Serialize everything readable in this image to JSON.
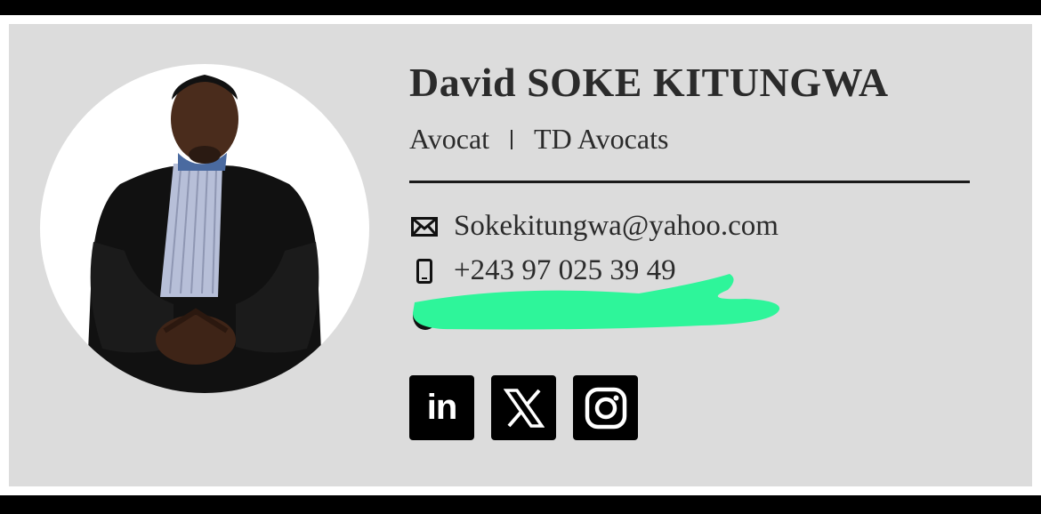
{
  "profile": {
    "name": "David SOKE KITUNGWA",
    "title": "Avocat",
    "company": "TD Avocats"
  },
  "contact": {
    "email": "Sokekitungwa@yahoo.com",
    "phone": "+243 97 025 39 49",
    "email_icon": "envelope-icon",
    "phone_icon": "mobile-phone-icon"
  },
  "socials": [
    {
      "name": "linkedin",
      "label": "in"
    },
    {
      "name": "x",
      "label": ""
    },
    {
      "name": "instagram",
      "label": ""
    }
  ],
  "colors": {
    "card_bg": "#dcdcdc",
    "text": "#2b2b2b",
    "redaction": "#2ef59a"
  }
}
